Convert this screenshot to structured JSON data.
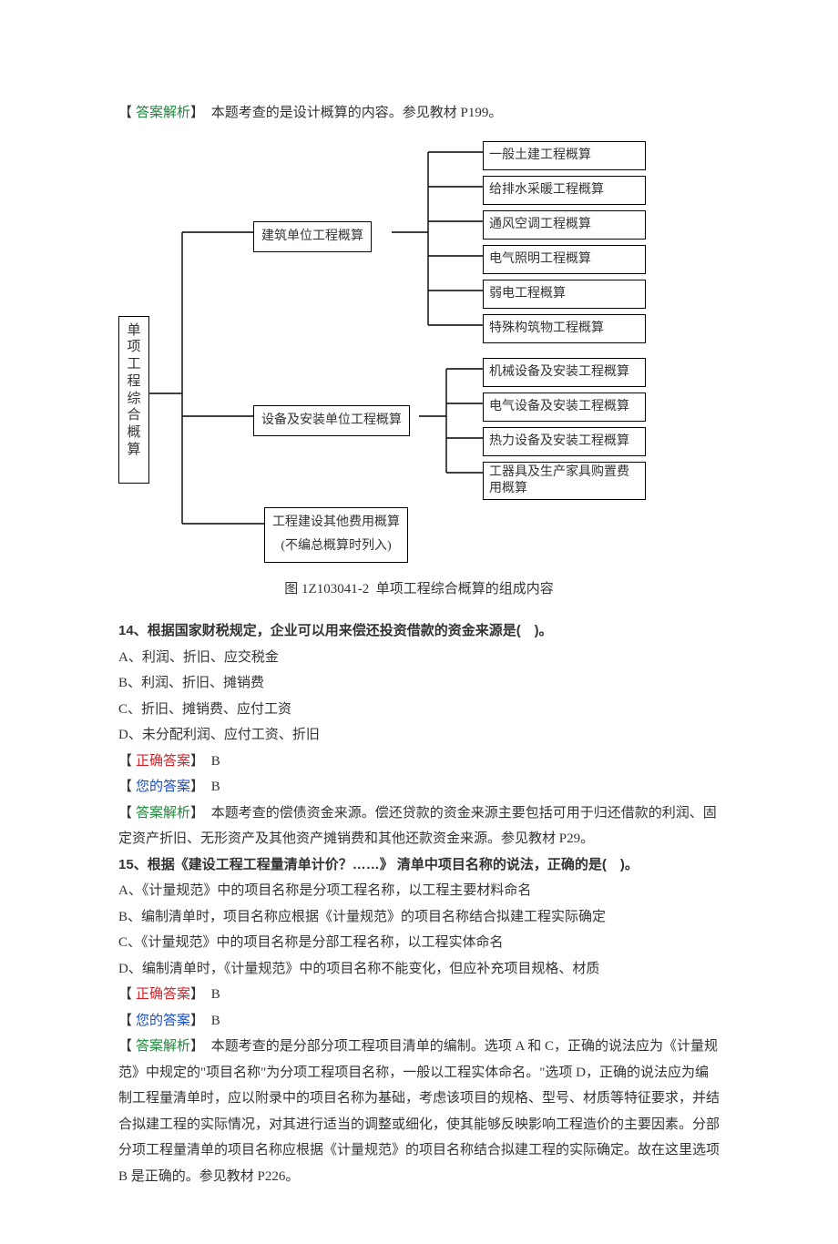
{
  "q13_explain_label": "答案解析",
  "q13_explain": " 本题考查的是设计概算的内容。参见教材 P199。",
  "diagram": {
    "root": "单\n项\n工\n程\n综\n合\n概\n算",
    "mid1": "建筑单位工程概算",
    "mid2": "设备及安装单位工程概算",
    "mid3_line1": "工程建设其他费用概算",
    "mid3_line2": "(不编总概算时列入)",
    "r1": "一般土建工程概算",
    "r2": "给排水采暖工程概算",
    "r3": "通风空调工程概算",
    "r4": "电气照明工程概算",
    "r5": "弱电工程概算",
    "r6": "特殊构筑物工程概算",
    "r7": "机械设备及安装工程概算",
    "r8": "电气设备及安装工程概算",
    "r9": "热力设备及安装工程概算",
    "r10_line1": "工器具及生产家具购置费",
    "r10_line2": "用概算",
    "caption_no": "图 1Z103041-2",
    "caption_text": "单项工程综合概算的组成内容"
  },
  "q14": {
    "num": "14、",
    "stem": "根据国家财税规定，企业可以用来偿还投资借款的资金来源是(　)。",
    "optA": "A、利润、折旧、应交税金",
    "optB": "B、利润、折旧、摊销费",
    "optC": "C、折旧、摊销费、应付工资",
    "optD": "D、未分配利润、应付工资、折旧",
    "correct_label": "正确答案",
    "correct": " B",
    "your_label": "您的答案",
    "your": " B",
    "explain_label": "答案解析",
    "explain": " 本题考查的偿债资金来源。偿还贷款的资金来源主要包括可用于归还借款的利润、固定资产折旧、无形资产及其他资产摊销费和其他还款资金来源。参见教材 P29。"
  },
  "q15": {
    "num": "15、",
    "stem": "根据《建设工程工程量清单计价？……》 清单中项目名称的说法，正确的是(　)。",
    "optA": "A、《计量规范》中的项目名称是分项工程名称，以工程主要材料命名",
    "optB": "B、编制清单时，项目名称应根据《计量规范》的项目名称结合拟建工程实际确定",
    "optC": "C、《计量规范》中的项目名称是分部工程名称，以工程实体命名",
    "optD": "D、编制清单时，《计量规范》中的项目名称不能变化，但应补充项目规格、材质",
    "correct_label": "正确答案",
    "correct": " B",
    "your_label": "您的答案",
    "your": " B",
    "explain_label": "答案解析",
    "explain": " 本题考查的是分部分项工程项目清单的编制。选项 A 和 C，正确的说法应为《计量规范》中规定的\"项目名称\"为分项工程项目名称，一般以工程实体命名。\"选项 D，正确的说法应为编制工程量清单时，应以附录中的项目名称为基础，考虑该项目的规格、型号、材质等特征要求，并结合拟建工程的实际情况，对其进行适当的调整或细化，使其能够反映影响工程造价的主要因素。分部分项工程量清单的项目名称应根据《计量规范》的项目名称结合拟建工程的实际确定。故在这里选项 B 是正确的。参见教材 P226。"
  }
}
